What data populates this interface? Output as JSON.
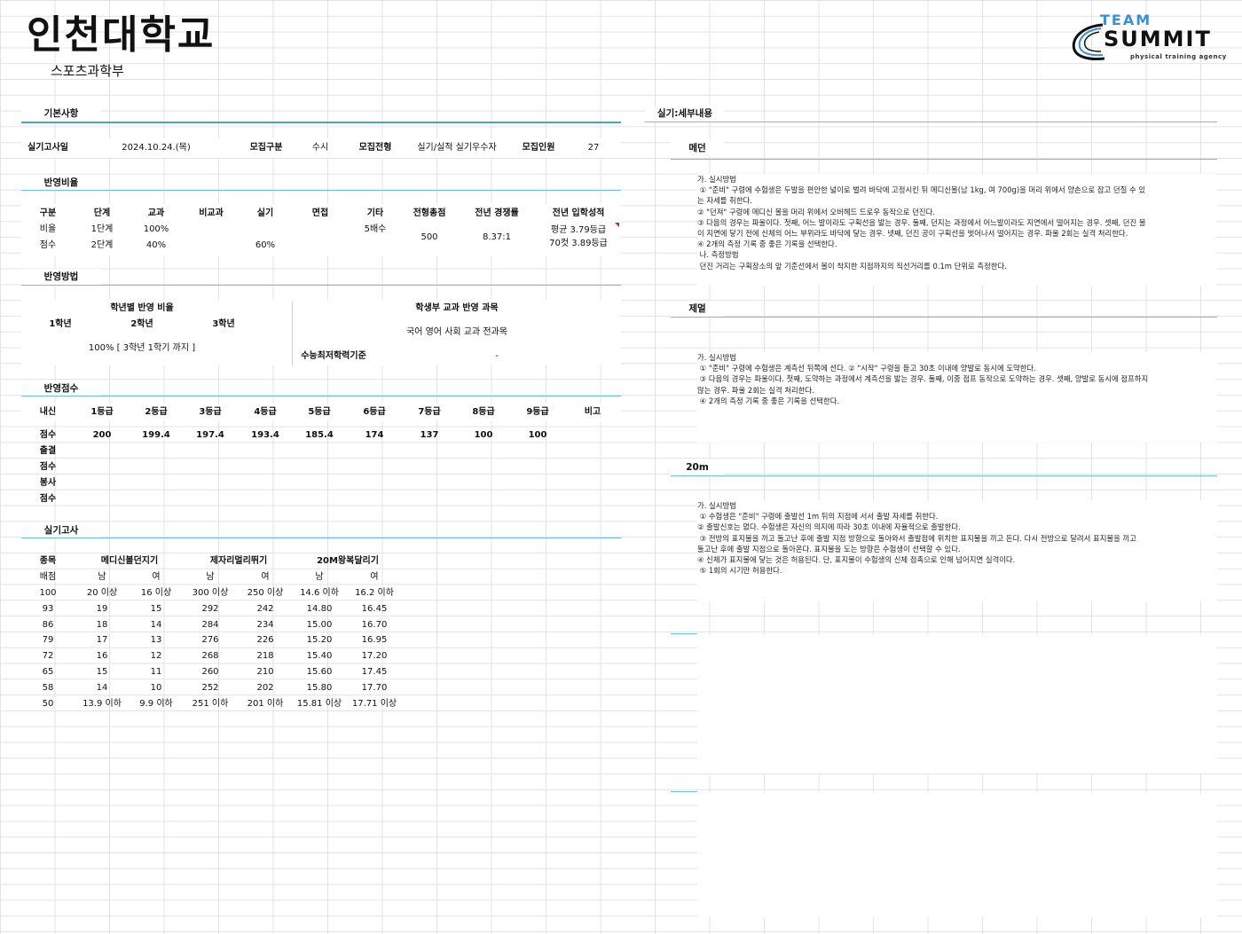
{
  "header": {
    "title": "인천대학교",
    "subtitle": "스포츠과학부",
    "logo": {
      "team": "TEAM",
      "summit": "SUMMIT",
      "agency": "physical training agency"
    }
  },
  "sections": {
    "basic": "기본사항",
    "ratio": "반영비율",
    "method": "반영방법",
    "score": "반영점수",
    "practical": "실기고사",
    "detail": "실기:세부내용"
  },
  "basic_info": {
    "exam_date_label": "실기고사일",
    "exam_date": "2024.10.24.(목)",
    "type_label": "모집구분",
    "type": "수시",
    "track_label": "모집전형",
    "track": "실기/실적 실기우수자",
    "quota_label": "모집인원",
    "quota": "27"
  },
  "ratio": {
    "headers": [
      "구분",
      "단계",
      "교과",
      "비교과",
      "실기",
      "면접",
      "기타",
      "전형총점",
      "전년 경쟁률",
      "전년 입학성적"
    ],
    "rows": [
      [
        "비율",
        "1단계",
        "100%",
        "",
        "",
        "",
        "5배수"
      ],
      [
        "점수",
        "2단계",
        "40%",
        "",
        "60%",
        "",
        ""
      ]
    ],
    "total": "500",
    "competition": "8.37:1",
    "admission_avg": "평균 3.79등급",
    "admission_cut": "70컷 3.89등급"
  },
  "method": {
    "grade_ratio_title": "학년별 반영 비율",
    "grades": [
      "1학년",
      "2학년",
      "3학년"
    ],
    "grade_ratio_value": "100% [ 3학년 1학기 까지 ]",
    "subjects_title": "학생부 교과 반영 과목",
    "subjects_value": "국어 영어 사회 교과 전과목",
    "csat_label": "수능최저학력기준",
    "csat_value": "-"
  },
  "score": {
    "headers": [
      "내신",
      "1등급",
      "2등급",
      "3등급",
      "4등급",
      "5등급",
      "6등급",
      "7등급",
      "8등급",
      "9등급",
      "비고"
    ],
    "score_label": "점수",
    "values": [
      "200",
      "199.4",
      "197.4",
      "193.4",
      "185.4",
      "174",
      "137",
      "100",
      "100"
    ],
    "extra_labels": [
      "출결",
      "점수",
      "봉사",
      "점수"
    ]
  },
  "practical": {
    "header_event": "종목",
    "events": [
      "메디신볼던지기",
      "제자리멀리뛰기",
      "20M왕복달리기"
    ],
    "sub_label": "배점",
    "genders": [
      "남",
      "여",
      "남",
      "여",
      "남",
      "여"
    ],
    "rows": [
      [
        "100",
        "20 이상",
        "16 이상",
        "300 이상",
        "250 이상",
        "14.6 이하",
        "16.2 이하"
      ],
      [
        "93",
        "19",
        "15",
        "292",
        "242",
        "14.80",
        "16.45"
      ],
      [
        "86",
        "18",
        "14",
        "284",
        "234",
        "15.00",
        "16.70"
      ],
      [
        "79",
        "17",
        "13",
        "276",
        "226",
        "15.20",
        "16.95"
      ],
      [
        "72",
        "16",
        "12",
        "268",
        "218",
        "15.40",
        "17.20"
      ],
      [
        "65",
        "15",
        "11",
        "260",
        "210",
        "15.60",
        "17.45"
      ],
      [
        "58",
        "14",
        "10",
        "252",
        "202",
        "15.80",
        "17.70"
      ],
      [
        "50",
        "13.9 이하",
        "9.9 이하",
        "251 이하",
        "201 이하",
        "15.81 이상",
        "17.71 이상"
      ]
    ]
  },
  "details": [
    {
      "name": "메던",
      "text": "가. 실시방법\n ① \"준비\" 구령에 수험생은 두발을 편안한 넓이로 벌려 바닥에 고정시킨 뒤 메디신볼(남 1kg, 여 700g)을 머리 위에서 양손으로 잡고 던질 수 있\n는 자세를 취한다.\n② \"던져\" 구령에 메디신 볼을 머리 위에서 오버헤드 드로우 동작으로 던진다.\n③ 다음의 경우는 파울이다. 첫째, 어느 발이라도 구획선을 밟는 경우. 둘째, 던지는 과정에서 어느발이라도 지면에서 떨어지는 경우. 셋째, 던진 볼\n이 지면에 닿기 전에 신체의 어느 부위라도 바닥에 닿는 경우. 넷째, 던진 공이 구획선을 벗어나서 떨어지는 경우. 파울 2회는 실격 처리한다.\n④ 2개의 측정 기록 중 좋은 기록을 선택한다.\n 나. 측정방법\n 던진 거리는 구획장소의 앞 기준선에서 볼이 착지한 지점까지의 직선거리를 0.1m 단위로 측정한다."
    },
    {
      "name": "제멀",
      "text": "가. 실시방법\n ① \"준비\" 구령에 수험생은 계측선 뒤쪽에 선다. ② \"시작\" 구령을 듣고 30초 이내에 양발로 동시에 도약한다.\n ③ 다음의 경우는 파울이다. 첫째, 도약하는 과정에서 계측선을 밟는 경우. 둘째, 이중 점프 동작으로 도약하는 경우. 셋째, 양발로 동시에 점프하지\n않는 경우. 파울 2회는 실격 처리한다.\n ④ 2개의 측정 기록 중 좋은 기록을 선택한다."
    },
    {
      "name": "20m",
      "text": "가. 실시방법\n ① 수험생은 \"준비\" 구령에 출발선 1m 뒤의 지점에 서서 출발 자세를 취한다.\n② 출발신호는 없다. 수험생은 자신의 의지에 따라 30초 이내에 자율적으로 출발한다.\n ③ 전방의 표지물을 끼고 돌고난 후에 출발 지점 방향으로 돌아와서 출발점에 위치한 표지물을 끼고 돈다. 다시 전방으로 달려서 표지물을 끼고\n돌고난 후에 출발 지점으로 돌아온다. 표지물을 도는 방향은 수험생이 선택할 수 있다.\n④ 신체가 표지물에 닿는 것은 허용된다. 단, 표지물이 수험생의 신체 접촉으로 인해 넘어지면 실격이다.\n ⑤ 1회의 시기만 허용한다."
    }
  ]
}
